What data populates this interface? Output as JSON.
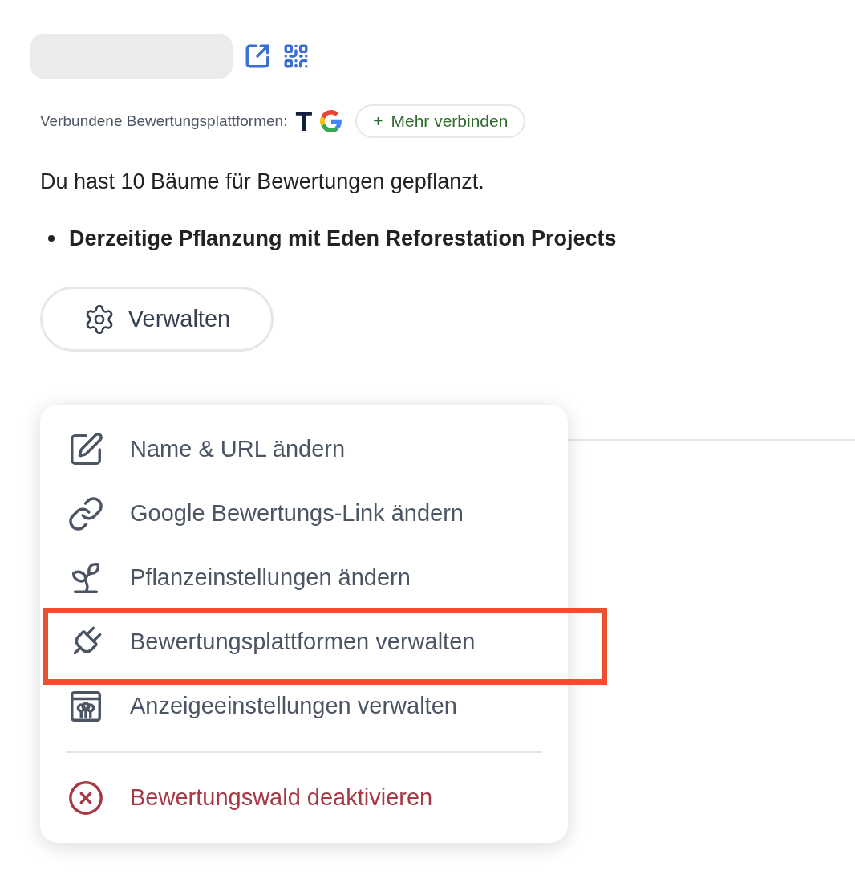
{
  "header": {
    "platforms_label": "Verbundene Bewertungsplattformen:",
    "platforms": [
      {
        "kind": "letter",
        "label": "T"
      },
      {
        "kind": "google"
      }
    ],
    "connect_button": {
      "icon": "+",
      "label": "Mehr verbinden"
    }
  },
  "summary": "Du hast 10 Bäume für Bewertungen gepflanzt.",
  "bullets": [
    "Derzeitige Pflanzung mit Eden Reforestation Projects"
  ],
  "manage_button": {
    "label": "Verwalten"
  },
  "menu": {
    "items": [
      {
        "kind": "edit",
        "label": "Name & URL ändern",
        "danger": false,
        "highlighted": false
      },
      {
        "kind": "link",
        "label": "Google Bewertungs-Link ändern",
        "danger": false,
        "highlighted": false
      },
      {
        "kind": "plant",
        "label": "Pflanzeinstellungen ändern",
        "danger": false,
        "highlighted": false
      },
      {
        "kind": "plug",
        "label": "Bewertungsplattformen verwalten",
        "danger": false,
        "highlighted": true
      },
      {
        "kind": "display",
        "label": "Anzeigeeinstellungen verwalten",
        "danger": false,
        "highlighted": false
      },
      {
        "kind": "divider"
      },
      {
        "kind": "deactivate",
        "label": "Bewertungswald deaktivieren",
        "danger": true,
        "highlighted": false
      }
    ]
  }
}
